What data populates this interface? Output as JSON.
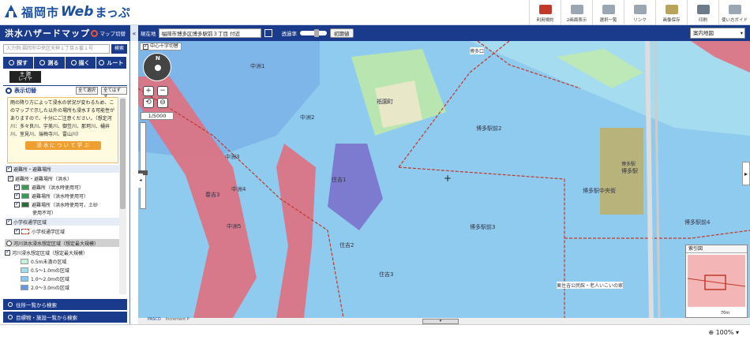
{
  "header": {
    "logo_city": "福岡市",
    "logo_web": "Web",
    "logo_map": "まっぷ",
    "tools": [
      {
        "label": "利用規約",
        "color": "#c0392b"
      },
      {
        "label": "2画面表示",
        "color": "#7f8c8d"
      },
      {
        "label": "選択一覧",
        "color": "#7f8c8d"
      },
      {
        "label": "リンク",
        "color": "#7f8c8d"
      },
      {
        "label": "画像保存",
        "color": "#7f8c8d"
      },
      {
        "label": "印刷",
        "color": "#7f8c8d"
      },
      {
        "label": "使い方ガイド",
        "color": "#7f8c8d"
      }
    ]
  },
  "panel": {
    "title": "洪水ハザードマップ",
    "switch_label": "マップ切替",
    "search_placeholder": "入力例:福岡市中央区天神１丁目８番１号",
    "search_btn": "検索",
    "nav": [
      "探す",
      "測る",
      "描く",
      "ルート"
    ],
    "theme_btn_line1": "主 題",
    "theme_btn_line2": "レイヤ",
    "display_toggle": "表示切替",
    "select_all": "全て選択",
    "deselect_all": "全てはずす",
    "note_text": "雨の降り方によって浸水の状況が変わるため、このマップで示した以外の場所も浸水する可能性がありますので、十分にご注意ください。（想定河川：多々良川、宇美川、御笠川、那珂川、樋井川、室見川、瑞梅寺川、雷山川）",
    "note_btn": "浸 水 に つ い て 学 ぶ",
    "layers": {
      "evac_section": "避難所・避難場所",
      "evac_flood": "避難所・避難場所（洪水）",
      "evac_a": "避難所（洪水時使用可）",
      "evac_b": "避難場所（洪水時使用可）",
      "evac_c": "避難場所（洪水時使用可，土砂",
      "evac_c2": "使用不可）",
      "school_section": "小学校通学区域",
      "school_item": "小学校通学区域",
      "river_radio": "河川洪水浸水想定区域（想定最大規模）",
      "river_section": "河川浸水想定区域（想定最大規模）",
      "depth": [
        {
          "label": "0.5m未満の区域",
          "color": "#c7f0d9"
        },
        {
          "label": "0.5～1.0mの区域",
          "color": "#9fe0ef"
        },
        {
          "label": "1.0～2.0mの区域",
          "color": "#86c8f0"
        },
        {
          "label": "2.0～3.0mの区域",
          "color": "#6a98e0"
        }
      ]
    },
    "bottom_nav": [
      "住所一覧から検索",
      "目標物・施設一覧から検索"
    ]
  },
  "mapbar": {
    "current_label": "現在地",
    "address": "福岡市博多区博多駅前３丁目 付近",
    "transparency_label": "透過率",
    "initial_btn": "初期値",
    "base_map": "案内地図"
  },
  "map": {
    "center_label": "中心十字切替",
    "scale": "1/5000",
    "labels": [
      "中洲1",
      "中洲2",
      "中洲3",
      "中洲4",
      "中洲5",
      "住吉1",
      "住吉2",
      "住吉3",
      "春吉3",
      "祇園町",
      "博多駅前2",
      "博多駅前3",
      "博多駅前4",
      "博多駅",
      "博多駅中央街",
      "東住吉公民館・老人いこいの家",
      "博多駅",
      "博多口"
    ],
    "pasco": "PASCO",
    "increment": "Increment P",
    "minimap_title": "索引図",
    "minimap_scale": "70m"
  },
  "status": {
    "zoom": "100%"
  }
}
